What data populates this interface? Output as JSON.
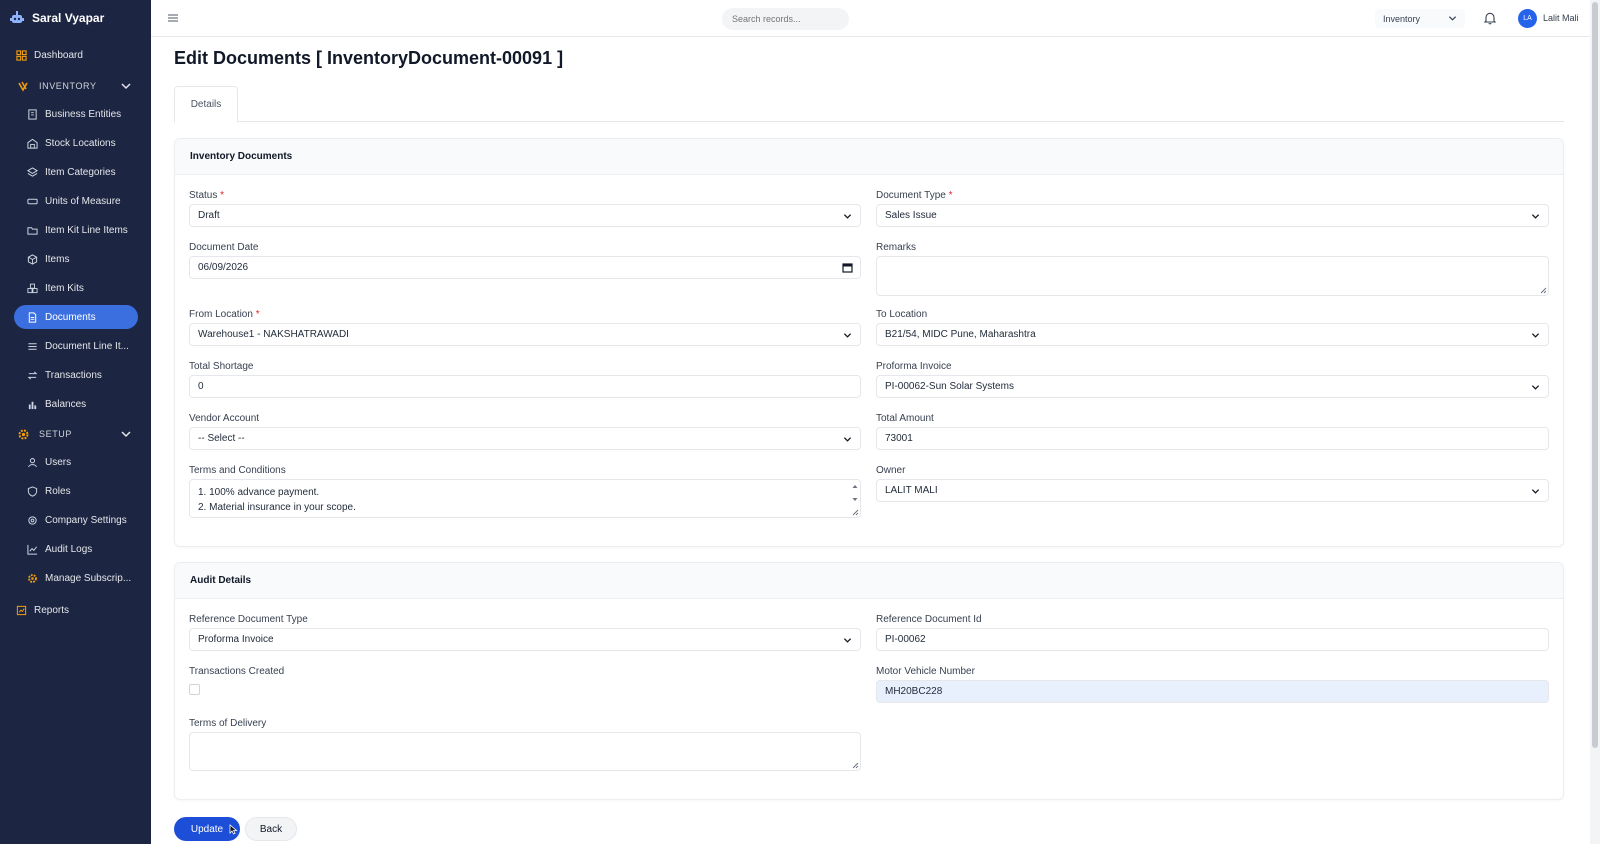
{
  "app": {
    "name": "Saral Vyapar"
  },
  "sidebar": {
    "dashboard": "Dashboard",
    "inventory_section": "INVENTORY",
    "inventory_items": [
      "Business Entities",
      "Stock Locations",
      "Item Categories",
      "Units of Measure",
      "Item Kit Line Items",
      "Items",
      "Item Kits",
      "Documents",
      "Document Line It...",
      "Transactions",
      "Balances"
    ],
    "setup_section": "SETUP",
    "setup_items": [
      "Users",
      "Roles",
      "Company Settings",
      "Audit Logs",
      "Manage Subscrip..."
    ],
    "reports": "Reports"
  },
  "header": {
    "search_placeholder": "Search records...",
    "module": "Inventory",
    "avatar_initials": "LA",
    "user_name": "Lalit Mali"
  },
  "page": {
    "title": "Edit Documents [ InventoryDocument-00091 ]",
    "tab_details": "Details"
  },
  "inventory_card": {
    "title": "Inventory Documents",
    "status_label": "Status",
    "status_value": "Draft",
    "doc_type_label": "Document Type",
    "doc_type_value": "Sales Issue",
    "doc_date_label": "Document Date",
    "doc_date_value": "06/09/2026",
    "remarks_label": "Remarks",
    "from_location_label": "From Location",
    "from_location_value": "Warehouse1 - NAKSHATRAWADI",
    "to_location_label": "To Location",
    "to_location_value": "B21/54, MIDC Pune, Maharashtra",
    "total_shortage_label": "Total Shortage",
    "total_shortage_value": "0",
    "proforma_label": "Proforma Invoice",
    "proforma_value": "PI-00062-Sun Solar Systems",
    "vendor_label": "Vendor Account",
    "vendor_value": "-- Select --",
    "total_amount_label": "Total Amount",
    "total_amount_value": "73001",
    "terms_label": "Terms and Conditions",
    "terms_line1": "1. 100% advance payment.",
    "terms_line2": "2. Material insurance in your scope.",
    "owner_label": "Owner",
    "owner_value": "LALIT MALI"
  },
  "audit_card": {
    "title": "Audit Details",
    "ref_type_label": "Reference Document Type",
    "ref_type_value": "Proforma Invoice",
    "ref_id_label": "Reference Document Id",
    "ref_id_value": "PI-00062",
    "transactions_label": "Transactions Created",
    "vehicle_label": "Motor Vehicle Number",
    "vehicle_value": "MH20BC228",
    "delivery_label": "Terms of Delivery"
  },
  "actions": {
    "update": "Update",
    "back": "Back"
  }
}
